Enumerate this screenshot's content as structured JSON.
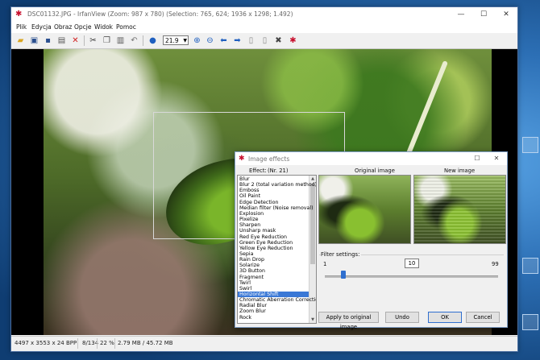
{
  "window": {
    "title": "DSC01132.JPG - IrfanView (Zoom: 987 x 780)  (Selection: 765, 624; 1936 x 1298; 1.492)",
    "controls": {
      "minimize": "—",
      "maximize": "☐",
      "close": "✕"
    }
  },
  "menu": [
    "Plik",
    "Edycja",
    "Obraz",
    "Opcje",
    "Widok",
    "Pomoc"
  ],
  "toolbar": {
    "zoom_value": "21.9",
    "icons": [
      "open-icon",
      "slideshow-icon",
      "save-icon",
      "print-icon",
      "delete-icon",
      "cut-icon",
      "copy-icon",
      "paste-icon",
      "undo-icon",
      "info-icon",
      "zoom-in-icon",
      "zoom-out-icon",
      "previous-icon",
      "next-icon",
      "first-page-icon",
      "last-page-icon",
      "settings-icon",
      "irfanview-icon"
    ]
  },
  "statusbar": {
    "dimensions": "4497 x 3553 x 24 BPP",
    "index": "8/134",
    "zoom": "22 %",
    "size": "2.79 MB / 45.72 MB"
  },
  "dialog": {
    "title": "Image effects",
    "effect_label": "Effect:",
    "count_label": "(Nr. 21)",
    "original_label": "Original image",
    "new_label": "New image",
    "effects": [
      "Blur",
      "Blur 2 (total variation method)",
      "Emboss",
      "Oil Paint",
      "Edge Detection",
      "Median filter (Noise removal)",
      "Explosion",
      "Pixelize",
      "Sharpen",
      "Unsharp mask",
      "Red Eye Reduction",
      "Green Eye Reduction",
      "Yellow Eye Reduction",
      "Sepia",
      "Rain Drop",
      "Solarize",
      "3D Button",
      "Fragment",
      "Twirl",
      "Swirl",
      "Horizontal Shift",
      "Chromatic Aberration Correction",
      "Radial Blur",
      "Zoom Blur",
      "Rock"
    ],
    "selected_index": 20,
    "filter_settings_label": "Filter settings:",
    "slider_min": "1",
    "slider_max": "99",
    "slider_value": "10",
    "slider_fraction": 0.092,
    "buttons": {
      "apply": "Apply to original image",
      "undo": "Undo",
      "ok": "OK",
      "cancel": "Cancel"
    }
  },
  "colors": {
    "accent": "#3a78d6",
    "app_icon": "#c8102e",
    "desktop": "#2c6fb5"
  }
}
